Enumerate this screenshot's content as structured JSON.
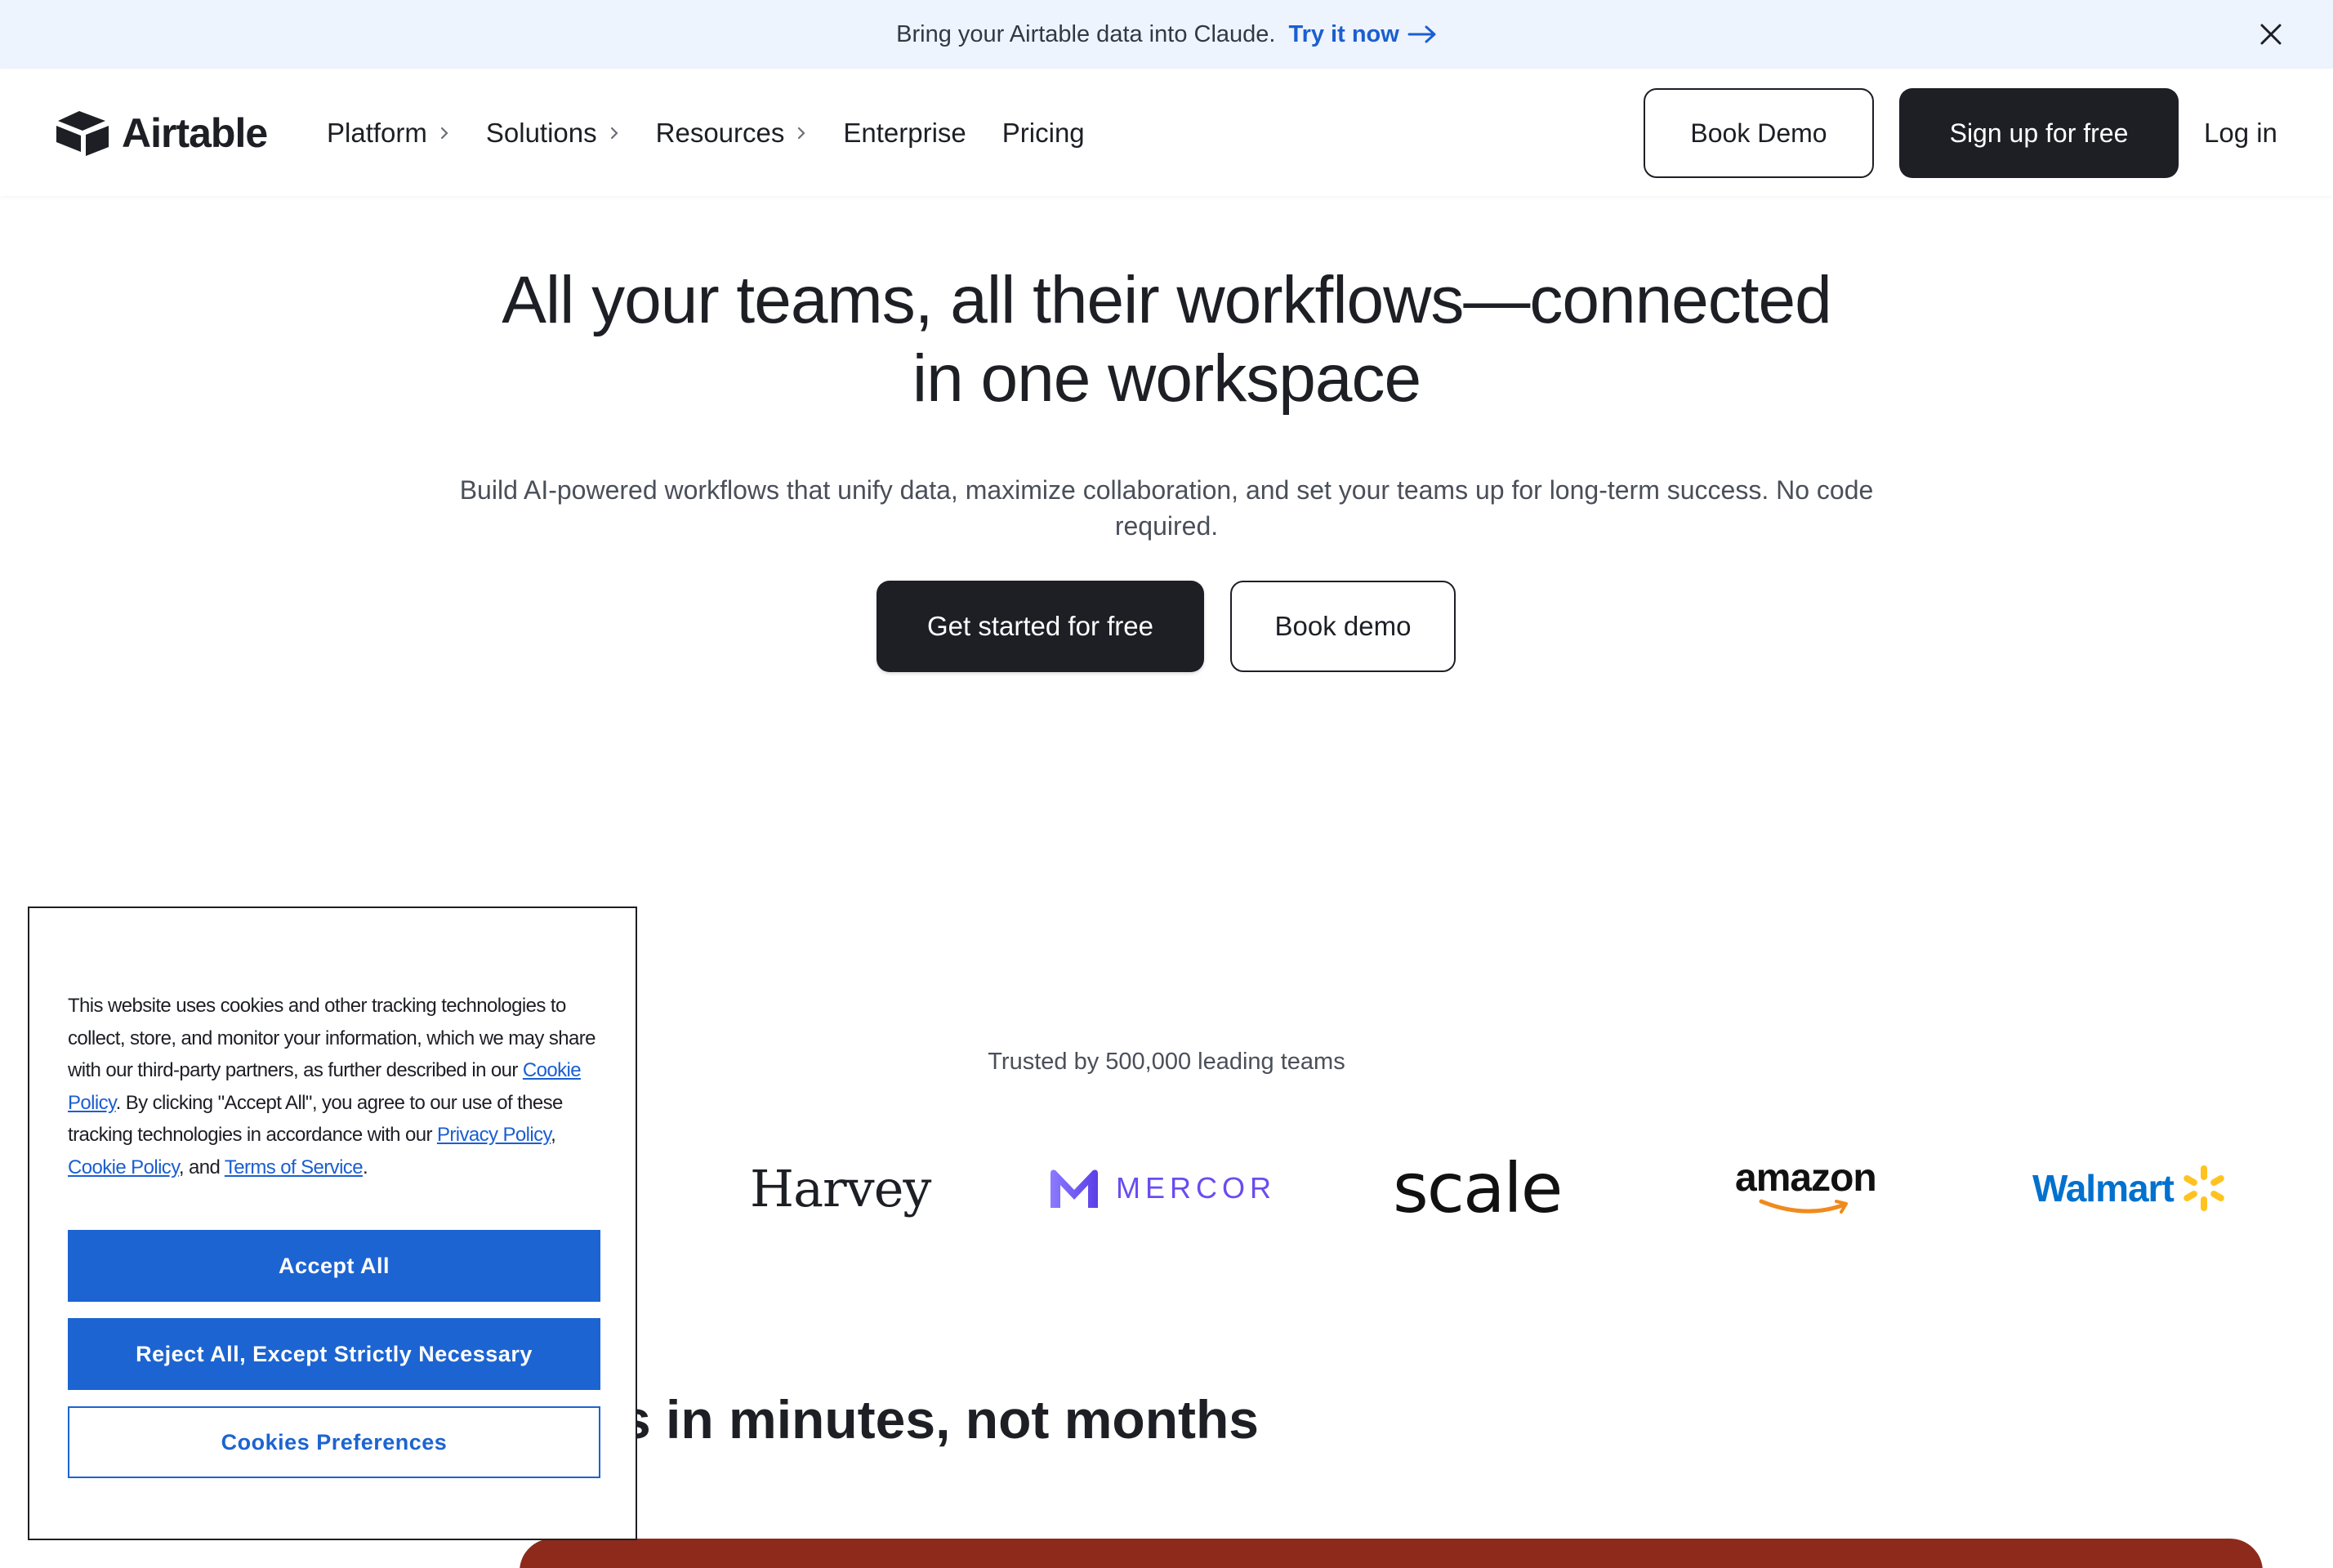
{
  "announcement": {
    "text": "Bring your Airtable data into Claude.",
    "link_label": "Try it now"
  },
  "header": {
    "logo_text": "Airtable",
    "nav": [
      {
        "label": "Platform",
        "has_chevron": true
      },
      {
        "label": "Solutions",
        "has_chevron": true
      },
      {
        "label": "Resources",
        "has_chevron": true
      },
      {
        "label": "Enterprise",
        "has_chevron": false
      },
      {
        "label": "Pricing",
        "has_chevron": false
      }
    ],
    "book_demo_label": "Book Demo",
    "signup_label": "Sign up for free",
    "login_label": "Log in"
  },
  "hero": {
    "title_line1": "All your teams, all their workflows—connected",
    "title_line2": "in one workspace",
    "subtitle": "Build AI-powered workflows that unify data, maximize collaboration, and set your teams up for long-term success. No code required.",
    "cta_primary": "Get started for free",
    "cta_secondary": "Book demo"
  },
  "trusted": {
    "text": "Trusted by 500,000 leading teams",
    "brands": [
      "Harvey",
      "MERCOR",
      "scale",
      "amazon",
      "Walmart"
    ]
  },
  "section": {
    "heading_visible": "s in minutes, not months"
  },
  "cookie": {
    "text_1": "This website uses cookies and other tracking technologies to collect, store, and monitor your information, which we may share with our third-party partners, as further described in our ",
    "link_cookie_policy": "Cookie Policy",
    "text_2": ". By clicking \"Accept All\", you agree to our use of these tracking technologies in accordance with our ",
    "link_privacy_policy": "Privacy Policy",
    "text_3": ", ",
    "link_cookie_policy_2": "Cookie Policy",
    "text_4": ", and ",
    "link_terms": "Terms of Service",
    "text_5": ".",
    "accept_label": "Accept All",
    "reject_label": "Reject All, Except Strictly Necessary",
    "prefs_label": "Cookies Preferences"
  },
  "colors": {
    "announce_bg": "#eef4fd",
    "link_blue": "#1b5fd0",
    "dark": "#1d1f25",
    "cookie_blue": "#1c64d1",
    "red_block": "#8d2a1c"
  },
  "icons": {
    "close": "close-icon",
    "arrow": "arrow-right-icon",
    "chevron": "chevron-right-icon",
    "logo": "airtable-logo-icon"
  }
}
